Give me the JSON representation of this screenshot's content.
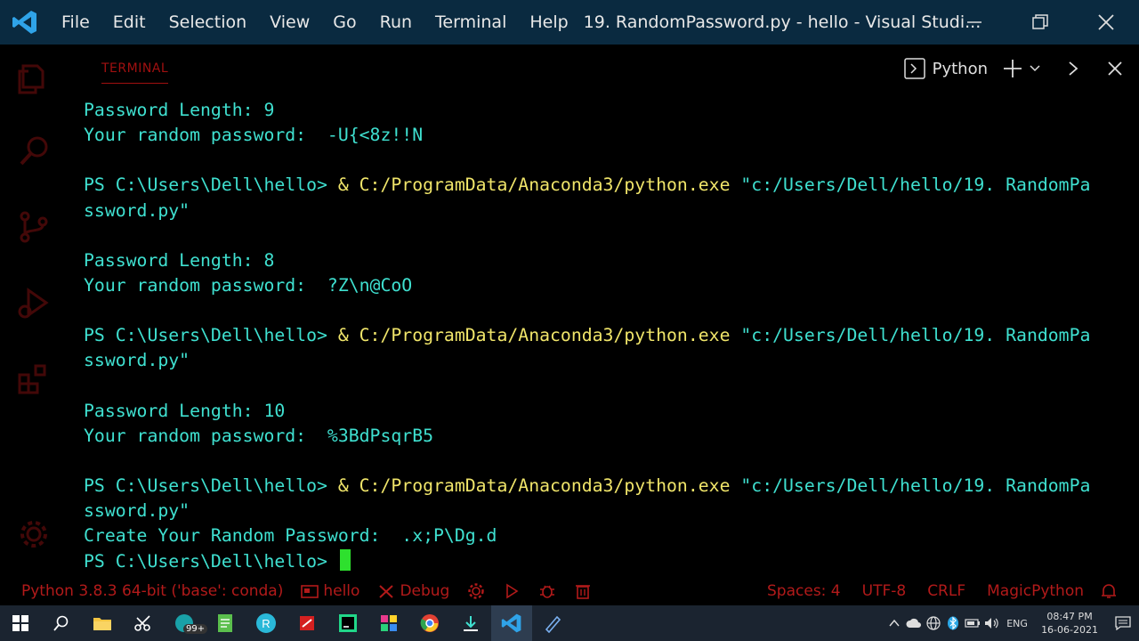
{
  "titlebar": {
    "menu": [
      "File",
      "Edit",
      "Selection",
      "View",
      "Go",
      "Run",
      "Terminal",
      "Help"
    ],
    "window_title": "19. RandomPassword.py - hello - Visual Studi..."
  },
  "panel": {
    "tab_label": "TERMINAL",
    "shell_name": "Python"
  },
  "terminal": {
    "lines": [
      {
        "segments": [
          {
            "text": "Password Length: 9",
            "color": "cyan"
          }
        ]
      },
      {
        "segments": [
          {
            "text": "Your random password:  -U{<8z!!N",
            "color": "cyan"
          }
        ]
      },
      {
        "segments": []
      },
      {
        "segments": [
          {
            "text": "PS C:\\Users\\Dell\\hello> ",
            "color": "cyan"
          },
          {
            "text": "& C:/ProgramData/Anaconda3/python.exe ",
            "color": "yellow"
          },
          {
            "text": "\"c:/Users/Dell/hello/19. RandomPa",
            "color": "cyan"
          }
        ]
      },
      {
        "segments": [
          {
            "text": "ssword.py\"",
            "color": "cyan"
          }
        ]
      },
      {
        "segments": []
      },
      {
        "segments": [
          {
            "text": "Password Length: 8",
            "color": "cyan"
          }
        ]
      },
      {
        "segments": [
          {
            "text": "Your random password:  ?Z\\n@CoO",
            "color": "cyan"
          }
        ]
      },
      {
        "segments": []
      },
      {
        "segments": [
          {
            "text": "PS C:\\Users\\Dell\\hello> ",
            "color": "cyan"
          },
          {
            "text": "& C:/ProgramData/Anaconda3/python.exe ",
            "color": "yellow"
          },
          {
            "text": "\"c:/Users/Dell/hello/19. RandomPa",
            "color": "cyan"
          }
        ]
      },
      {
        "segments": [
          {
            "text": "ssword.py\"",
            "color": "cyan"
          }
        ]
      },
      {
        "segments": []
      },
      {
        "segments": [
          {
            "text": "Password Length: 10",
            "color": "cyan"
          }
        ]
      },
      {
        "segments": [
          {
            "text": "Your random password:  %3BdPsqrB5",
            "color": "cyan"
          }
        ]
      },
      {
        "segments": []
      },
      {
        "segments": [
          {
            "text": "PS C:\\Users\\Dell\\hello> ",
            "color": "cyan"
          },
          {
            "text": "& C:/ProgramData/Anaconda3/python.exe ",
            "color": "yellow"
          },
          {
            "text": "\"c:/Users/Dell/hello/19. RandomPa",
            "color": "cyan"
          }
        ]
      },
      {
        "segments": [
          {
            "text": "ssword.py\"",
            "color": "cyan"
          }
        ]
      },
      {
        "segments": [
          {
            "text": "Create Your Random Password:  .x;P\\Dg.d",
            "color": "cyan"
          }
        ]
      },
      {
        "segments": [
          {
            "text": "PS C:\\Users\\Dell\\hello> ",
            "color": "cyan"
          }
        ],
        "cursor": true
      }
    ]
  },
  "statusbar": {
    "interpreter": "Python 3.8.3 64-bit ('base': conda)",
    "branch": "hello",
    "debug": "Debug",
    "spaces": "Spaces: 4",
    "encoding": "UTF-8",
    "eol": "CRLF",
    "language": "MagicPython"
  },
  "taskbar": {
    "badge": "99+",
    "lang": "ENG",
    "time": "08:47 PM",
    "date": "16-06-2021"
  },
  "colors": {
    "titlebar_bg": "#0a2a40",
    "accent_red": "#b21a1a",
    "terminal_cyan": "#3fe0d0",
    "terminal_yellow": "#f0e56a",
    "cursor_green": "#2ee02e"
  }
}
